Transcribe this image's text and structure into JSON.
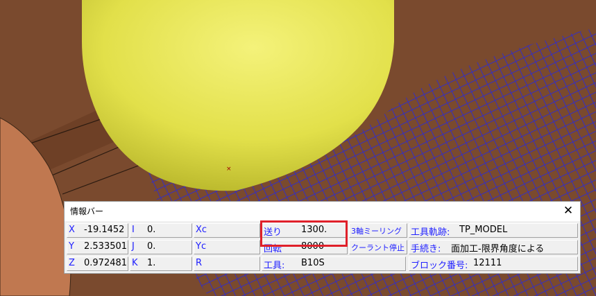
{
  "window": {
    "title": "情報バー",
    "close_glyph": "✕"
  },
  "info": {
    "x": {
      "label": "X",
      "value": "-19.1452"
    },
    "y": {
      "label": "Y",
      "value": "2.533501"
    },
    "z": {
      "label": "Z",
      "value": "0.972481"
    },
    "i": {
      "label": "I",
      "value": "0."
    },
    "j": {
      "label": "J",
      "value": "0."
    },
    "k": {
      "label": "K",
      "value": "1."
    },
    "xc": {
      "label": "Xc"
    },
    "yc": {
      "label": "Yc"
    },
    "r": {
      "label": "R"
    },
    "feed": {
      "label": "送り",
      "value": "1300."
    },
    "spindle": {
      "label": "回転",
      "value": "8000"
    },
    "tool": {
      "label": "工具:",
      "value": "B10S"
    },
    "misc1": {
      "label": "3軸ミーリング"
    },
    "misc2": {
      "label": "クーラント停止"
    },
    "toolpath": {
      "label": "工具軌跡:",
      "value": "TP_MODEL"
    },
    "procedure": {
      "label": "手続き:",
      "value": "面加工-限界角度による"
    },
    "block": {
      "label": "ブロック番号:",
      "value": "12111"
    }
  },
  "colors": {
    "surface": "#7a4a2e",
    "part": "#c07850",
    "tool": "#e6e64a",
    "toolpath": "#2a2ad8",
    "highlight": "#e0202a"
  }
}
